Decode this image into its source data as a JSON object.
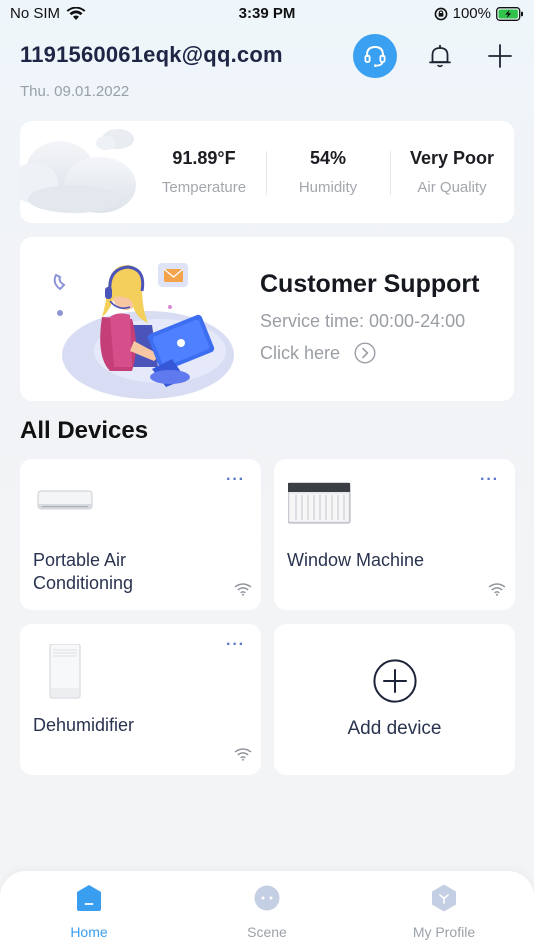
{
  "status_bar": {
    "carrier": "No SIM",
    "time": "3:39 PM",
    "battery": "100%"
  },
  "header": {
    "email": "1191560061eqk@qq.com",
    "date": "Thu. 09.01.2022"
  },
  "weather": {
    "temperature": {
      "value": "91.89°F",
      "label": "Temperature"
    },
    "humidity": {
      "value": "54%",
      "label": "Humidity"
    },
    "air_quality": {
      "value": "Very Poor",
      "label": "Air Quality"
    }
  },
  "support": {
    "title": "Customer Support",
    "service_time": "Service time: 00:00-24:00",
    "click_label": "Click here"
  },
  "devices": {
    "section_title": "All Devices",
    "items": [
      {
        "name_line1": "Portable Air",
        "name_line2": "Conditioning",
        "menu": "···"
      },
      {
        "name_line1": "Window Machine",
        "name_line2": "",
        "menu": "···"
      },
      {
        "name_line1": "Dehumidifier",
        "name_line2": "",
        "menu": "···"
      }
    ],
    "add_label": "Add device"
  },
  "tabs": [
    {
      "label": "Home",
      "icon": "home-icon",
      "active": true
    },
    {
      "label": "Scene",
      "icon": "scene-icon",
      "active": false
    },
    {
      "label": "My Profile",
      "icon": "profile-icon",
      "active": false
    }
  ],
  "colors": {
    "accent": "#3aa0f2",
    "menu_dots": "#5b76c9",
    "label_gray": "#a3a7ad"
  }
}
